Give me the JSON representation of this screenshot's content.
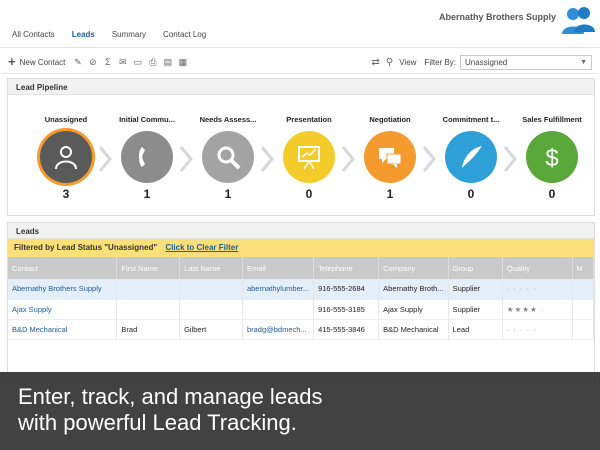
{
  "nav": {
    "tabs": [
      "All Contacts",
      "Leads",
      "Summary",
      "Contact Log"
    ],
    "active": 1
  },
  "header": {
    "company": "Abernathy Brothers Supply"
  },
  "toolbar": {
    "new_contact": "New Contact",
    "view": "View",
    "filter_by": "Filter By:",
    "filter_value": "Unassigned"
  },
  "pipeline": {
    "title": "Lead Pipeline",
    "stages": [
      {
        "name": "Unassigned",
        "count": "3",
        "color": "#5a5a5a",
        "icon": "person-icon"
      },
      {
        "name": "Initial Commu...",
        "count": "1",
        "color": "#8c8c8c",
        "icon": "phone-icon"
      },
      {
        "name": "Needs Assess...",
        "count": "1",
        "color": "#a3a3a3",
        "icon": "magnifier-icon"
      },
      {
        "name": "Presentation",
        "count": "0",
        "color": "#f3cb2b",
        "icon": "presentation-board-icon"
      },
      {
        "name": "Negotiation",
        "count": "1",
        "color": "#f59a2c",
        "icon": "chat-bubbles-icon"
      },
      {
        "name": "Commitment t...",
        "count": "0",
        "color": "#2f9fd8",
        "icon": "quill-icon"
      },
      {
        "name": "Sales Fulfillment",
        "count": "0",
        "color": "#5aa83a",
        "icon": "dollar-icon"
      }
    ]
  },
  "leads": {
    "title": "Leads",
    "filter_text": "Filtered by Lead Status \"Unassigned\"",
    "clear_link": "Click to Clear Filter",
    "columns": [
      "Contact",
      "First Name",
      "Last Name",
      "Email",
      "Telephone",
      "Company",
      "Group",
      "Quality",
      "M"
    ],
    "rows": [
      [
        "Abernathy Brothers Supply",
        "",
        "",
        "abernathylumber...",
        "916-555-2684",
        "Abernathy Broth...",
        "Supplier",
        "· · · · ·"
      ],
      [
        "Ajax Supply",
        "",
        "",
        "",
        "916-555-3185",
        "Ajax Supply",
        "Supplier",
        "★★★★ ·"
      ],
      [
        "B&D Mechanical",
        "Brad",
        "Gilbert",
        "bradg@bdmech...",
        "415-555-3846",
        "B&D Mechanical",
        "Lead",
        "· · · · ·"
      ]
    ]
  },
  "caption": {
    "line1": "Enter, track, and manage leads",
    "line2": "with powerful Lead Tracking."
  }
}
